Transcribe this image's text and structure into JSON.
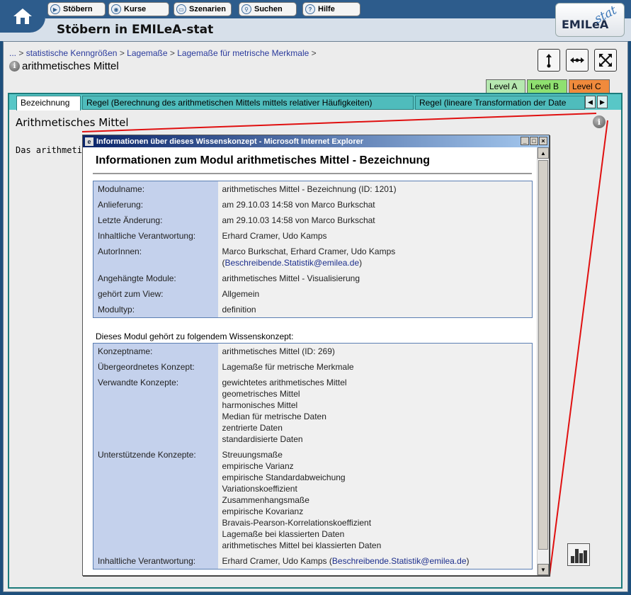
{
  "nav": {
    "buttons": [
      {
        "label": "Stöbern",
        "icon": "play-icon"
      },
      {
        "label": "Kurse",
        "icon": "eye-icon"
      },
      {
        "label": "Szenarien",
        "icon": "monitor-icon"
      },
      {
        "label": "Suchen",
        "icon": "magnifier-icon"
      },
      {
        "label": "Hilfe",
        "icon": "question-icon"
      }
    ]
  },
  "header": {
    "title": "Stöbern in EMILeA-stat",
    "logo_main": "EMILeA",
    "logo_stat": "stat"
  },
  "breadcrumb": {
    "items": [
      "...",
      "statistische Kenngrößen",
      "Lagemaße",
      "Lagemaße für metrische Merkmale"
    ],
    "separator": ">"
  },
  "concept_title": "arithmetisches Mittel",
  "levels": [
    {
      "label": "Level A",
      "color": "#b6e8b0"
    },
    {
      "label": "Level B",
      "color": "#8fe070"
    },
    {
      "label": "Level C",
      "color": "#f08a3c"
    }
  ],
  "tabs": [
    "Bezeichnung",
    "Regel (Berechnung des arithmetischen Mittels mittels relativer Häufigkeiten)",
    "Regel (lineare Transformation der Date"
  ],
  "content": {
    "title": "Arithmetisches Mittel",
    "text": "Das arithmetis"
  },
  "popup": {
    "window_title": "Informationen über dieses Wissenskonzept - Microsoft Internet Explorer",
    "heading": "Informationen zum Modul arithmetisches Mittel - Bezeichnung",
    "module_rows": [
      {
        "key": "Modulname:",
        "value": "arithmetisches Mittel - Bezeichnung (ID: 1201)"
      },
      {
        "key": "Anlieferung:",
        "value": "am 29.10.03 14:58 von Marco Burkschat"
      },
      {
        "key": "Letzte Änderung:",
        "value": "am 29.10.03 14:58 von Marco Burkschat"
      },
      {
        "key": "Inhaltliche Verantwortung:",
        "value": "Erhard Cramer, Udo Kamps"
      },
      {
        "key": "AutorInnen:",
        "value": "Marco Burkschat, Erhard Cramer, Udo Kamps",
        "email": "Beschreibende.Statistik@emilea.de"
      },
      {
        "key": "Angehängte Module:",
        "value": "arithmetisches Mittel - Visualisierung"
      },
      {
        "key": "gehört zum View:",
        "value": "Allgemein"
      },
      {
        "key": "Modultyp:",
        "value": "definition"
      }
    ],
    "concept_section_label": "Dieses Modul gehört zu folgendem Wissenskonzept:",
    "concept_rows": [
      {
        "key": "Konzeptname:",
        "value": "arithmetisches Mittel (ID: 269)"
      },
      {
        "key": "Übergeordnetes Konzept:",
        "value": "Lagemaße für metrische Merkmale"
      },
      {
        "key": "Verwandte Konzepte:",
        "values": [
          "gewichtetes arithmetisches Mittel",
          "geometrisches Mittel",
          "harmonisches Mittel",
          "Median für metrische Daten",
          "zentrierte Daten",
          "standardisierte Daten"
        ]
      },
      {
        "key": "Unterstützende Konzepte:",
        "values": [
          "Streuungsmaße",
          "empirische Varianz",
          "empirische Standardabweichung",
          "Variationskoeffizient",
          "Zusammenhangsmaße",
          "empirische Kovarianz",
          "Bravais-Pearson-Korrelationskoeffizient",
          "Lagemaße bei klassierten Daten",
          "arithmetisches Mittel bei klassierten Daten"
        ]
      },
      {
        "key": "Inhaltliche Verantwortung:",
        "value": "Erhard Cramer, Udo Kamps",
        "email": "Beschreibende.Statistik@emilea.de"
      }
    ]
  }
}
